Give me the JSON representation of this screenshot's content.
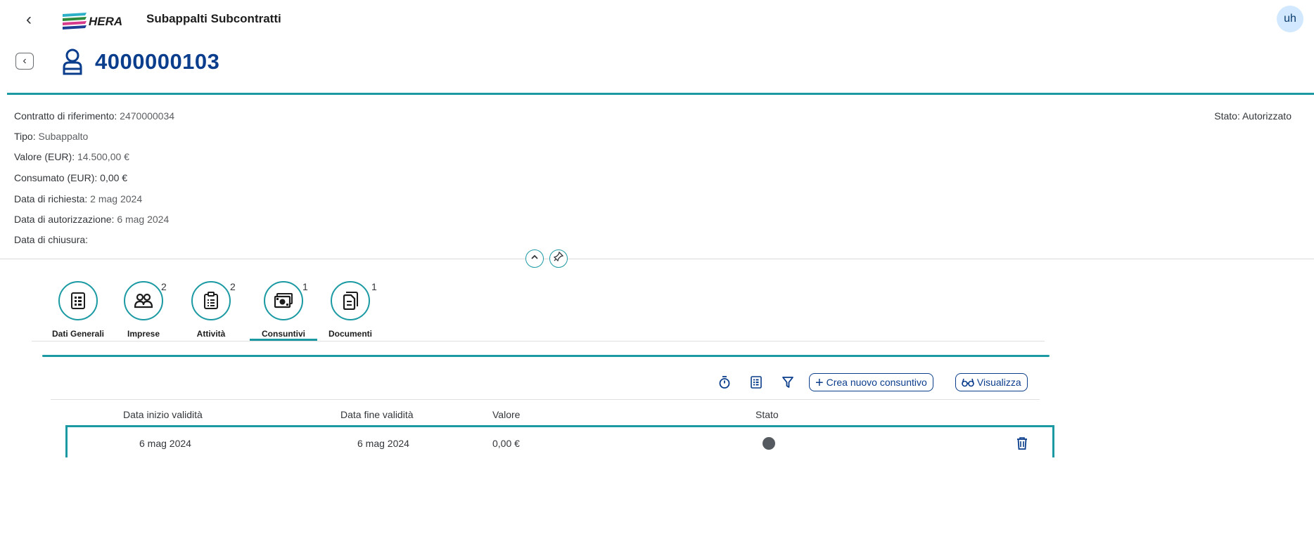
{
  "shell": {
    "back_label": "‹",
    "app_title": "Subappalti Subcontratti",
    "avatar_initials": "uh"
  },
  "object": {
    "back_label": "‹",
    "title": "4000000103"
  },
  "attributes": [
    {
      "label": "Contratto di riferimento: ",
      "value": "2470000034"
    },
    {
      "label": "Tipo: ",
      "value": "Subappalto"
    },
    {
      "label": "Valore (EUR): ",
      "value": "14.500,00 €"
    },
    {
      "label": "Consumato (EUR): ",
      "value": "0,00 €"
    },
    {
      "label": "Data di richiesta: ",
      "value": "2 mag 2024"
    },
    {
      "label": "Data di autorizzazione: ",
      "value": "6 mag 2024"
    },
    {
      "label": "Data di chiusura:",
      "value": ""
    }
  ],
  "status": {
    "label": "Stato: ",
    "value": "Autorizzato"
  },
  "tabs": [
    {
      "label": "Dati Generali",
      "count": ""
    },
    {
      "label": "Imprese",
      "count": "2"
    },
    {
      "label": "Attività",
      "count": "2"
    },
    {
      "label": "Consuntivi",
      "count": "1"
    },
    {
      "label": "Documenti",
      "count": "1"
    }
  ],
  "toolbar": {
    "create_label": "Crea nuovo consuntivo",
    "view_label": "Visualizza"
  },
  "table": {
    "columns": [
      "Data inizio validità",
      "Data fine validità",
      "Valore",
      "Stato"
    ],
    "rows": [
      {
        "start": "6 mag 2024",
        "end": "6 mag 2024",
        "value": "0,00 €",
        "status_color": "#555a60"
      }
    ]
  },
  "colors": {
    "accent": "#1b9aa3",
    "title": "#0a3d8c"
  }
}
